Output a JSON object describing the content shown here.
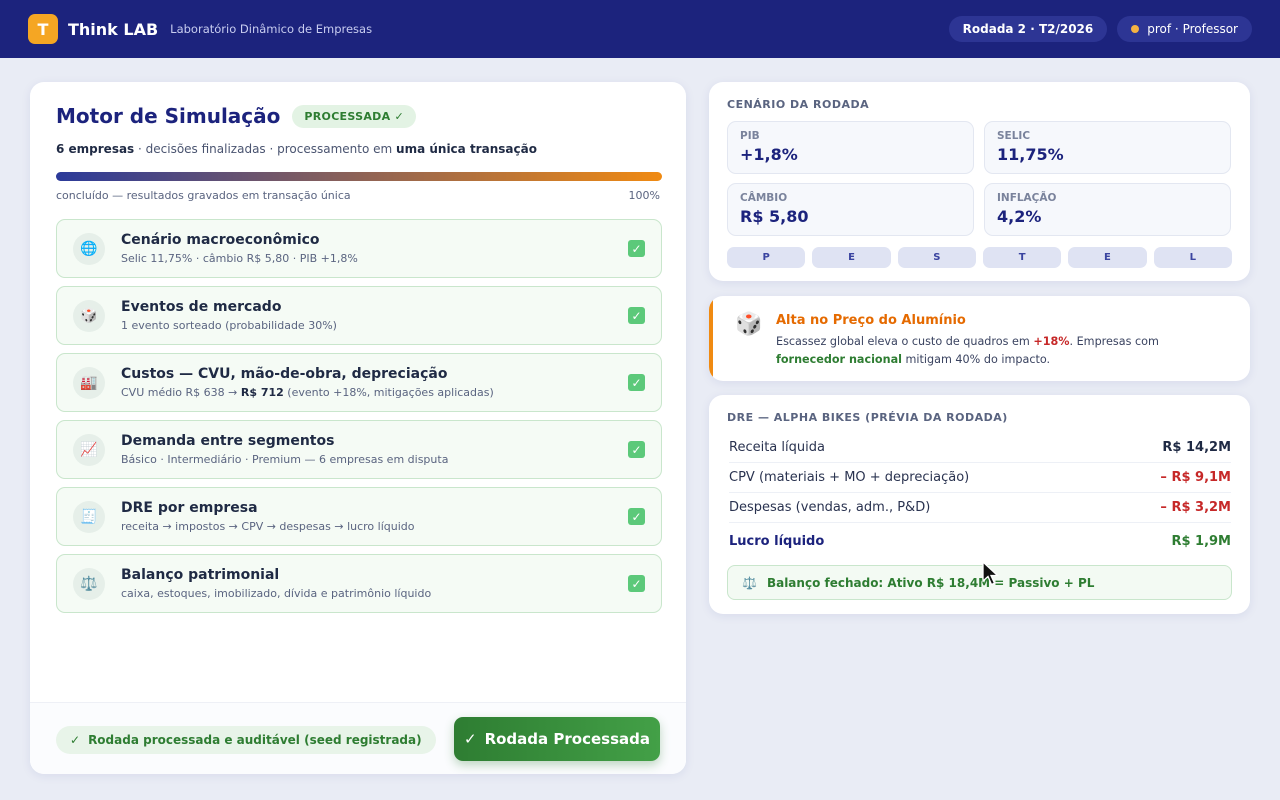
{
  "header": {
    "logo_letter": "T",
    "brand": "Think LAB",
    "subtitle": "Laboratório Dinâmico de Empresas",
    "round": "Rodada 2 · T2/2026",
    "user": "prof · Professor"
  },
  "simulation": {
    "title": "Motor de Simulação",
    "status_badge": "PROCESSADA ✓",
    "subtitle_companies": "6 empresas",
    "subtitle_mid": " · decisões finalizadas · processamento em ",
    "subtitle_strong": "uma única transação",
    "progress_value": 100,
    "progress_label": "concluído — resultados gravados em transação única",
    "progress_percent": "100%",
    "steps": [
      {
        "icon": "🌐",
        "title": "Cenário macroeconômico",
        "desc": "Selic 11,75% · câmbio R$ 5,80 · PIB +1,8%"
      },
      {
        "icon": "🎲",
        "title": "Eventos de mercado",
        "desc": "1 evento sorteado (probabilidade 30%)"
      },
      {
        "icon": "🏭",
        "title": "Custos — CVU, mão-de-obra, depreciação",
        "desc_pre": "CVU médio R$ 638 → ",
        "desc_strong": "R$ 712",
        "desc_post": " (evento +18%, mitigações aplicadas)"
      },
      {
        "icon": "📈",
        "title": "Demanda entre segmentos",
        "desc": "Básico · Intermediário · Premium — 6 empresas em disputa"
      },
      {
        "icon": "🧾",
        "title": "DRE por empresa",
        "desc": "receita → impostos → CPV → despesas → lucro líquido"
      },
      {
        "icon": "⚖️",
        "title": "Balanço patrimonial",
        "desc": "caixa, estoques, imobilizado, dívida e patrimônio líquido"
      }
    ],
    "check_glyph": "✓",
    "audit_label": "Rodada processada e auditável (seed registrada)",
    "audit_check": "✓",
    "button_label": "Rodada Processada",
    "button_check": "✓"
  },
  "scenario": {
    "label": "CENÁRIO DA RODADA",
    "metrics": [
      {
        "label": "PIB",
        "value": "+1,8%"
      },
      {
        "label": "SELIC",
        "value": "11,75%"
      },
      {
        "label": "CÂMBIO",
        "value": "R$ 5,80"
      },
      {
        "label": "INFLAÇÃO",
        "value": "4,2%"
      }
    ],
    "pestel": [
      "P",
      "E",
      "S",
      "T",
      "E",
      "L"
    ]
  },
  "event": {
    "icon": "🎲",
    "title": "Alta no Preço do Alumínio",
    "desc_1": "Escassez global eleva o custo de quadros em ",
    "desc_red": "+18%",
    "desc_2": ". Empresas com ",
    "desc_green": "fornecedor nacional",
    "desc_3": " mitigam 40% do impacto."
  },
  "dre": {
    "label": "DRE — ALPHA BIKES (PRÉVIA DA RODADA)",
    "rows": [
      {
        "label": "Receita líquida",
        "value": "R$ 14,2M"
      },
      {
        "label": "CPV (materiais + MO + depreciação)",
        "value": "– R$ 9,1M"
      },
      {
        "label": "Despesas (vendas, adm., P&D)",
        "value": "– R$ 3,2M"
      },
      {
        "label": "Lucro líquido",
        "value": "R$ 1,9M"
      }
    ],
    "balance_icon": "⚖️",
    "balance_pre": "Balanço fechado: Ativo R$ 18,4M",
    "balance_post": " = Passivo + PL"
  },
  "colors": {
    "header_bg": "#1c237d",
    "accent_orange": "#f08a12",
    "success_green": "#2e7d32",
    "danger_red": "#c62828"
  }
}
